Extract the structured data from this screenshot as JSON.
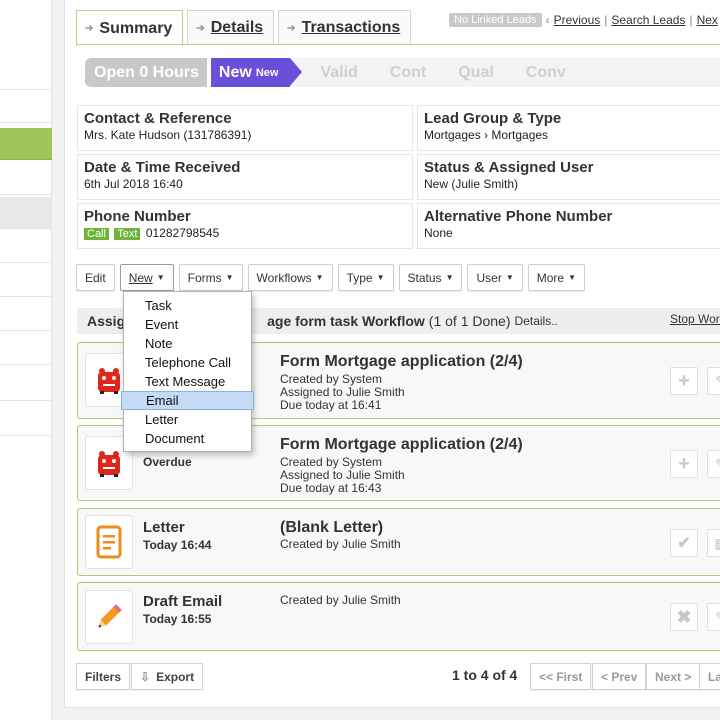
{
  "tabs": [
    {
      "label": "Summary"
    },
    {
      "label": "Details"
    },
    {
      "label": "Transactions"
    }
  ],
  "topnav": {
    "linked_badge": "No Linked Leads",
    "previous": "Previous",
    "search": "Search Leads",
    "next": "Nex"
  },
  "stages": {
    "open": "Open 0 Hours",
    "new": "New",
    "new_sub": "New",
    "valid": "Valid",
    "cont": "Cont",
    "qual": "Qual",
    "conv": "Conv"
  },
  "info": {
    "contact_label": "Contact & Reference",
    "contact_value": "Mrs. Kate Hudson (131786391)",
    "group_label": "Lead Group & Type",
    "group_value": "Mortgages › Mortgages",
    "date_label": "Date & Time Received",
    "date_value": "6th Jul 2018 16:40",
    "status_label": "Status & Assigned User",
    "status_value": "New (Julie Smith)",
    "phone_label": "Phone Number",
    "call_badge": "Call",
    "text_badge": "Text",
    "phone_value": "01282798545",
    "alt_label": "Alternative Phone Number",
    "alt_value": "None"
  },
  "toolbar": {
    "edit": "Edit",
    "new": "New",
    "forms": "Forms",
    "workflows": "Workflows",
    "type": "Type",
    "status": "Status",
    "user": "User",
    "more": "More"
  },
  "workflow": {
    "prefix": "Assig",
    "name": "age form task Workflow",
    "count": "(1 of 1 Done)",
    "details": "Details..",
    "stop": "Stop Work"
  },
  "menu": {
    "items": [
      "Task",
      "Event",
      "Note",
      "Telephone Call",
      "Text Message",
      "Email",
      "Letter",
      "Document"
    ],
    "highlighted": "Email"
  },
  "cards": [
    {
      "title": "Form Mortgage application (2/4)",
      "line1": "Created by System",
      "line2": "Assigned to Julie Smith",
      "line3": "Due today at 16:41"
    },
    {
      "status": "Overdue",
      "title": "Form Mortgage application (2/4)",
      "line1": "Created by System",
      "line2": "Assigned to Julie Smith",
      "line3": "Due today at 16:43"
    },
    {
      "type": "Letter",
      "time": "Today 16:44",
      "title": "(Blank Letter)",
      "line1": "Created by Julie Smith"
    },
    {
      "type": "Draft Email",
      "time": "Today 16:55",
      "line1": "Created by Julie Smith"
    }
  ],
  "footer": {
    "filters": "Filters",
    "export": "Export",
    "page_info": "1 to 4 of 4",
    "first": "<< First",
    "prev": "< Prev",
    "next": "Next >",
    "last": "La"
  },
  "colors": {
    "accent_green": "#9dc55a",
    "stage_purple": "#6a4fd8",
    "card_border": "#a9cf6b",
    "highlight_blue": "#c4daf5"
  }
}
